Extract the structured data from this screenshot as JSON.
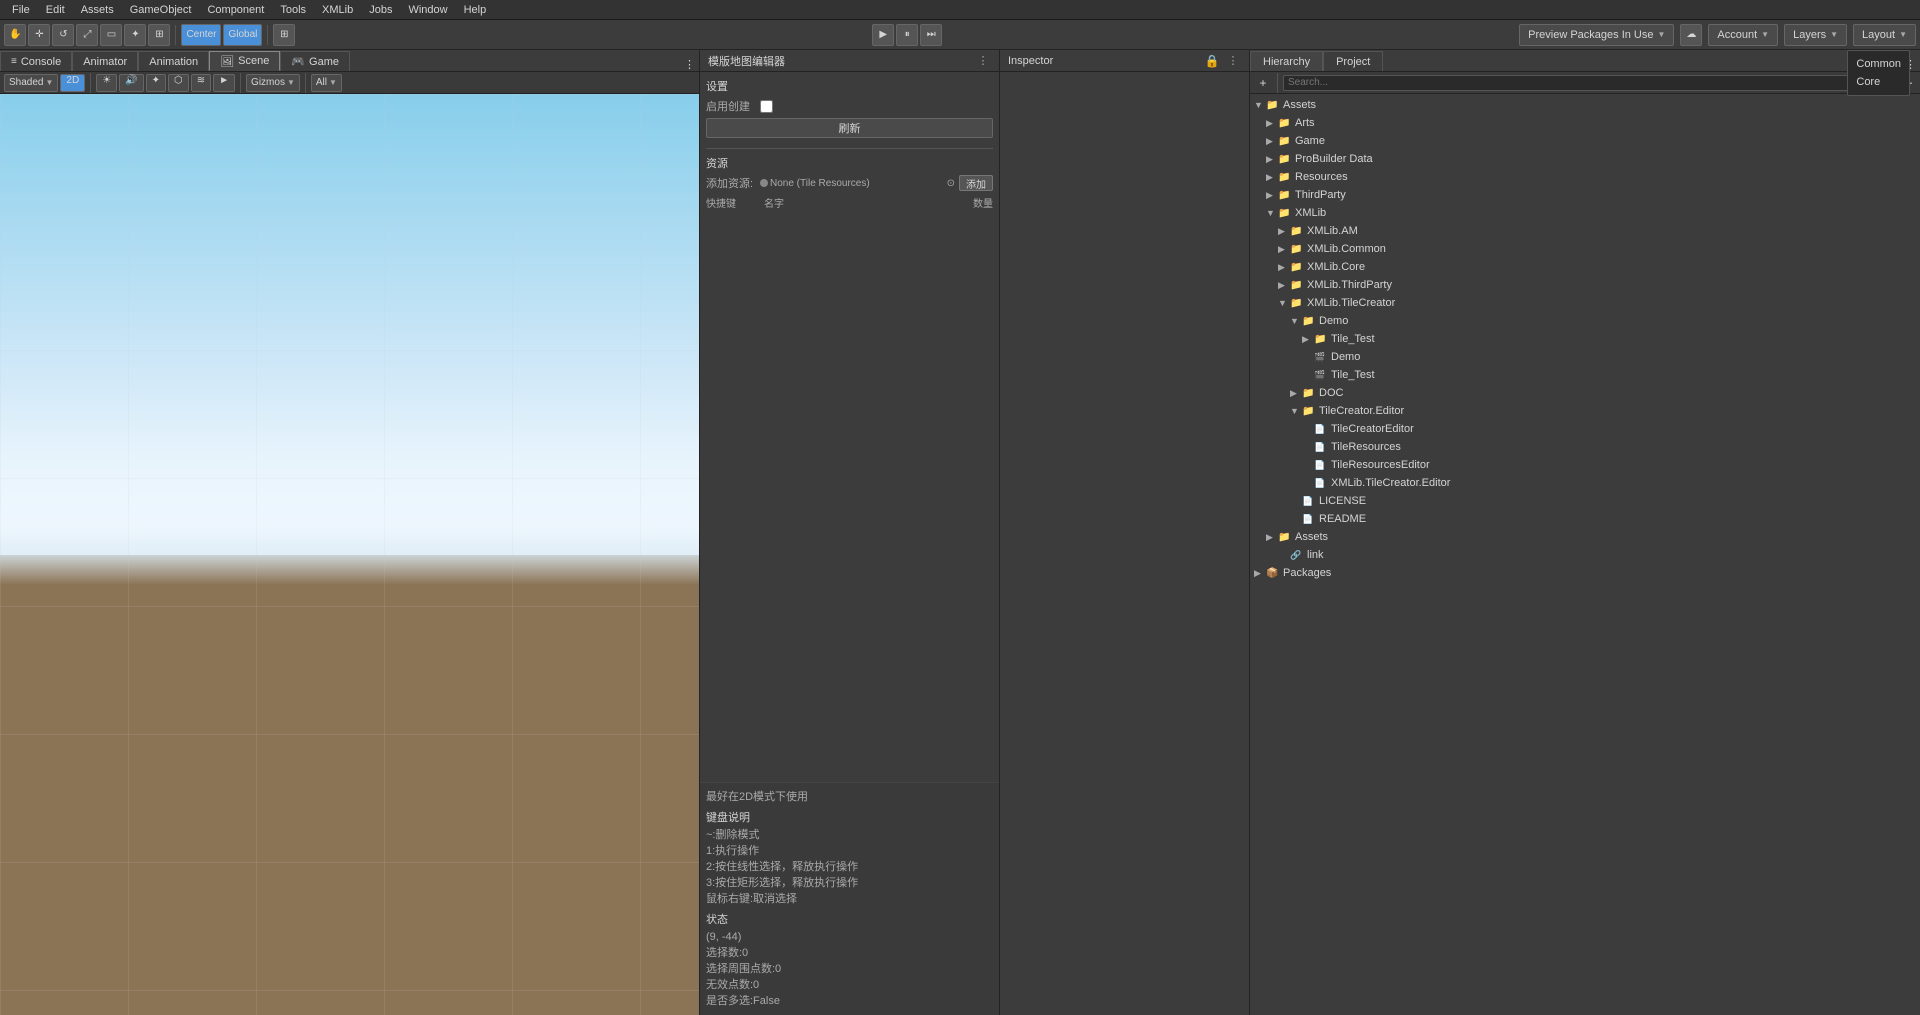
{
  "menu": {
    "items": [
      "File",
      "Edit",
      "Assets",
      "GameObject",
      "Component",
      "Tools",
      "XMLib",
      "Jobs",
      "Window",
      "Help"
    ]
  },
  "toolbar": {
    "transform_tools": [
      "⟳",
      "↔",
      "↺",
      "⤢",
      "✦",
      "☰"
    ],
    "center_label": "Center",
    "global_label": "Global",
    "play_pause_stop": [
      "▶",
      "⏸",
      "⏭"
    ],
    "account_label": "Account",
    "layers_label": "Layers",
    "layout_label": "Layout",
    "preview_packages_label": "Preview Packages In Use"
  },
  "scene_view": {
    "tabs": [
      "Console",
      "Animator",
      "Animation",
      "Scene",
      "Game"
    ],
    "active_tab": "Scene",
    "shading_mode": "Shaded",
    "view_2d": "2D",
    "gizmos_label": "Gizmos",
    "all_label": "All"
  },
  "tilemap_editor": {
    "title": "模版地图编辑器",
    "settings_label": "设置",
    "enable_create_label": "启用创建",
    "refresh_label": "刷新",
    "resources_label": "资源",
    "add_source_label": "添加资源:",
    "none_tile_resources": "None (Tile Resources)",
    "add_btn_label": "添加",
    "columns": {
      "shortcut": "快捷键",
      "name": "名字",
      "count": "数量"
    },
    "bottom_info": {
      "best_use_label": "最好在2D模式下使用",
      "keyboard_title": "键盘说明",
      "lines": [
        "~:删除模式",
        "1:执行操作",
        "2:按住线性选择，释放执行操作",
        "3:按住矩形选择，释放执行操作",
        "鼠标右键:取消选择"
      ],
      "status_title": "状态",
      "status_lines": [
        "(9, -44)",
        "选择数:0",
        "选择周围点数:0",
        "无效点数:0",
        "是否多选:False"
      ]
    }
  },
  "inspector": {
    "title": "Inspector"
  },
  "hierarchy": {
    "title": "Hierarchy"
  },
  "project": {
    "title": "Project",
    "tree": {
      "assets_root": "Assets",
      "children": [
        {
          "name": "Arts",
          "type": "folder",
          "indent": 1
        },
        {
          "name": "Game",
          "type": "folder",
          "indent": 1
        },
        {
          "name": "ProBuilder Data",
          "type": "folder",
          "indent": 1
        },
        {
          "name": "Resources",
          "type": "folder",
          "indent": 1
        },
        {
          "name": "ThirdParty",
          "type": "folder",
          "indent": 1
        },
        {
          "name": "XMLib",
          "type": "folder",
          "indent": 1,
          "expanded": true
        },
        {
          "name": "XMLib.AM",
          "type": "folder",
          "indent": 2
        },
        {
          "name": "XMLib.Common",
          "type": "folder",
          "indent": 2
        },
        {
          "name": "XMLib.Core",
          "type": "folder",
          "indent": 2
        },
        {
          "name": "XMLib.ThirdParty",
          "type": "folder",
          "indent": 2
        },
        {
          "name": "XMLib.TileCreator",
          "type": "folder",
          "indent": 2,
          "expanded": true
        },
        {
          "name": "Demo",
          "type": "folder",
          "indent": 3,
          "expanded": true
        },
        {
          "name": "Tile_Test",
          "type": "folder",
          "indent": 4
        },
        {
          "name": "Demo",
          "type": "scene",
          "indent": 4
        },
        {
          "name": "Tile_Test",
          "type": "scene",
          "indent": 4
        },
        {
          "name": "DOC",
          "type": "folder",
          "indent": 3
        },
        {
          "name": "TileCreator.Editor",
          "type": "folder",
          "indent": 3,
          "expanded": true
        },
        {
          "name": "TileCreatorEditor",
          "type": "file",
          "indent": 4
        },
        {
          "name": "TileResources",
          "type": "file",
          "indent": 4
        },
        {
          "name": "TileResourcesEditor",
          "type": "file",
          "indent": 4
        },
        {
          "name": "XMLib.TileCreator.Editor",
          "type": "file",
          "indent": 4
        },
        {
          "name": "LICENSE",
          "type": "file",
          "indent": 3
        },
        {
          "name": "README",
          "type": "file",
          "indent": 3
        },
        {
          "name": "Assets",
          "type": "folder",
          "indent": 1
        },
        {
          "name": "link",
          "type": "file",
          "indent": 2
        }
      ],
      "packages_root": "Packages"
    }
  },
  "packages_tooltip": {
    "common_label": "Common",
    "core_label": "Core"
  }
}
